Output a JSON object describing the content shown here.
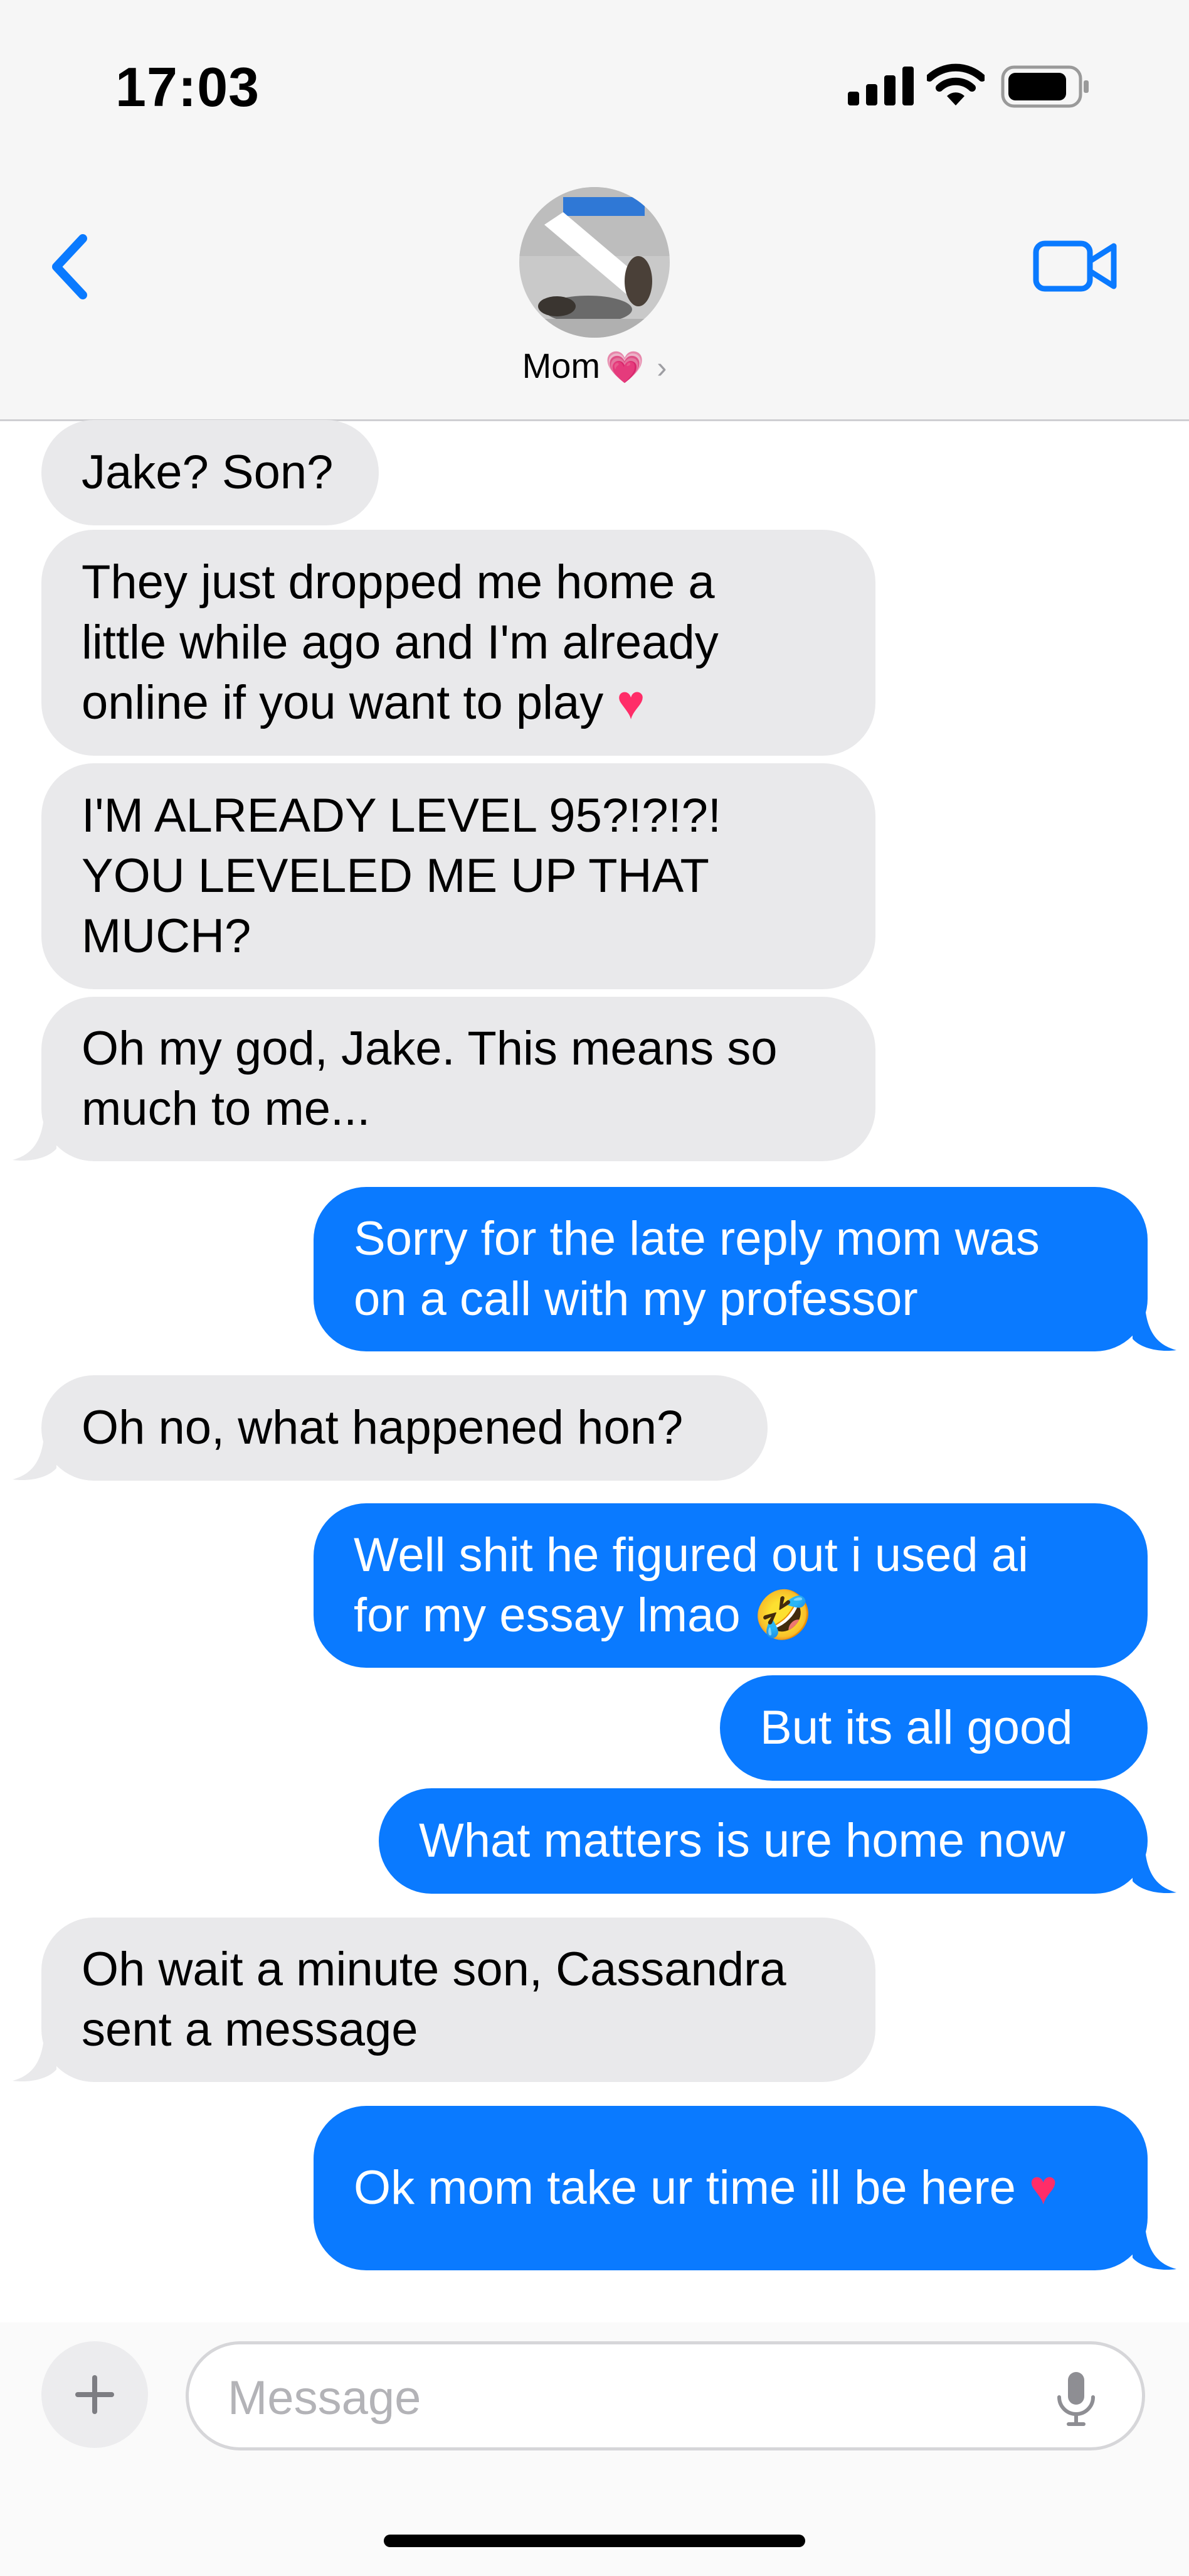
{
  "status": {
    "time": "17:03"
  },
  "header": {
    "contact_name": "Mom",
    "name_emoji": "💗"
  },
  "messages": [
    {
      "from": "them",
      "lines": [
        "Jake? Son?"
      ]
    },
    {
      "from": "them",
      "lines": [
        "They just dropped me home a",
        "little while ago and I'm already",
        "online if you want to play"
      ],
      "heart": true
    },
    {
      "from": "them",
      "lines": [
        "I'M ALREADY LEVEL 95?!?!?!",
        "YOU LEVELED ME UP THAT",
        "MUCH?"
      ]
    },
    {
      "from": "them",
      "lines": [
        "Oh my god, Jake. This means so",
        "much to me..."
      ]
    },
    {
      "from": "me",
      "lines": [
        "Sorry for the late reply mom was",
        "on a call with my professor"
      ]
    },
    {
      "from": "them",
      "lines": [
        "Oh no, what happened hon?"
      ]
    },
    {
      "from": "me",
      "lines": [
        "Well shit he figured out i used ai",
        "for my essay lmao 🤣"
      ]
    },
    {
      "from": "me",
      "lines": [
        "But its all good"
      ]
    },
    {
      "from": "me",
      "lines": [
        "What matters is ure home now"
      ]
    },
    {
      "from": "them",
      "lines": [
        "Oh wait a minute son, Cassandra",
        "sent a message"
      ]
    },
    {
      "from": "me",
      "lines": [
        "Ok mom take ur time ill be here"
      ],
      "heart": true
    }
  ],
  "composer": {
    "placeholder": "Message"
  },
  "icons": {
    "back": "chevron-left-icon",
    "video": "video-camera-icon",
    "plus": "plus-icon",
    "mic": "microphone-icon",
    "signal": "cellular-signal-icon",
    "wifi": "wifi-icon",
    "battery": "battery-icon"
  },
  "colors": {
    "accent": "#0a7aff",
    "incoming": "#e9e9eb",
    "heart": "#ff2d68"
  }
}
